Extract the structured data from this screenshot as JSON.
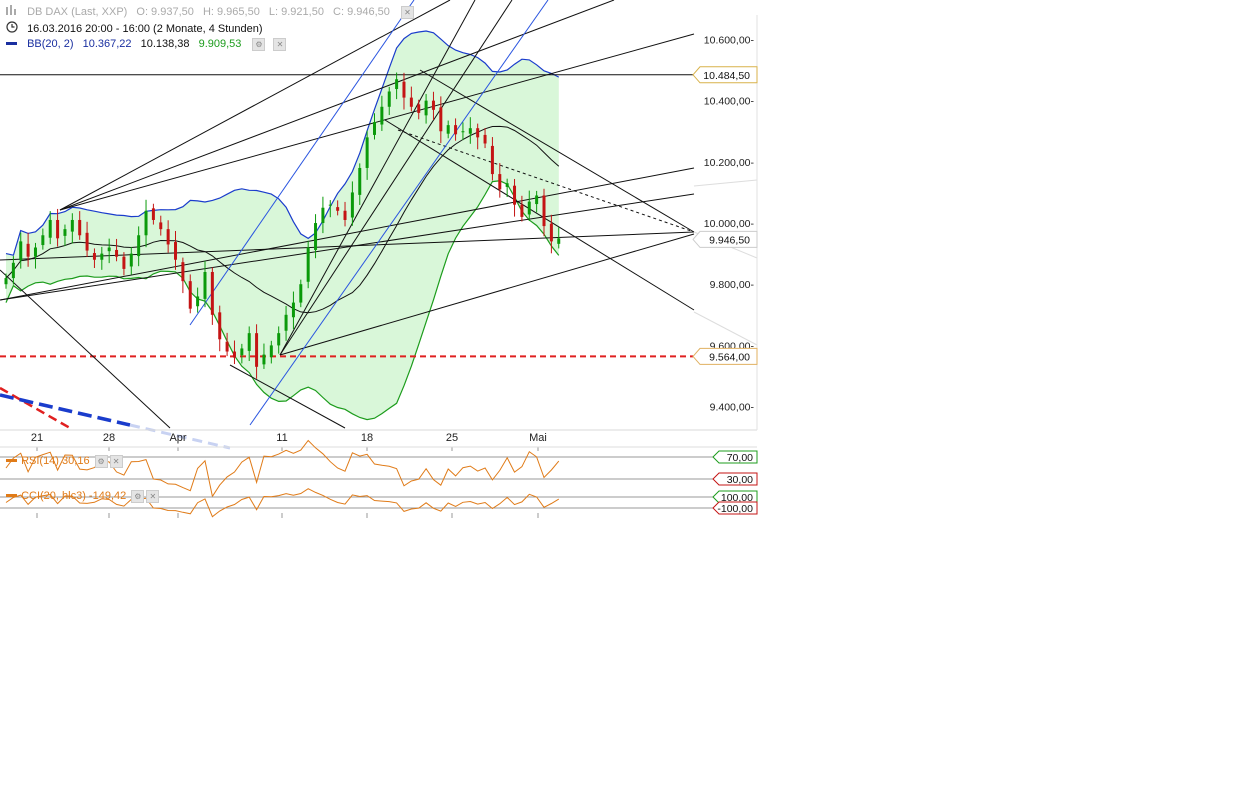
{
  "header": {
    "instrument": "DB DAX (Last, XXP)",
    "open": "O: 9.937,50",
    "high": "H: 9.965,50",
    "low": "L: 9.921,50",
    "close": "C: 9.946,50",
    "period": "16.03.2016 20:00 - 16:00 (2 Monate, 4 Stunden)",
    "bb_name": "BB(20, 2)",
    "bb_upper": "10.367,22",
    "bb_mid": "10.138,38",
    "bb_lower": "9.909,53"
  },
  "colors": {
    "up": "#0a9a0a",
    "down": "#c41414",
    "bb_line": "#1a3ccc",
    "bb_fill": "#d9f7d9",
    "bb_green": "#1c9c1c",
    "trend": "#111111",
    "channel_blue": "#2a55e0",
    "support": "#e02020",
    "indicator": "#e07b18"
  },
  "price_axis": {
    "ticks": [
      "10.600,00",
      "10.400,00",
      "10.200,00",
      "10.000,00",
      "9.800,00",
      "9.600,00",
      "9.400,00"
    ],
    "labels": [
      {
        "text": "10.484,50",
        "kind": "resistance"
      },
      {
        "text": "9.946,50",
        "kind": "last"
      },
      {
        "text": "9.564,00",
        "kind": "support"
      }
    ]
  },
  "date_axis": [
    "21",
    "28",
    "Apr",
    "11",
    "18",
    "25",
    "Mai"
  ],
  "rsi": {
    "label": "RSI(14)",
    "value": "30,16",
    "upper": "70,00",
    "lower": "30,00"
  },
  "cci": {
    "label": "CCI(20, hlc3)",
    "value": "-149,42",
    "upper": "100,00",
    "lower": "-100,00"
  },
  "chart_data": {
    "type": "candlestick",
    "title": "DB DAX (Last, XXP)",
    "x_labels": [
      "21",
      "28",
      "Apr",
      "11",
      "18",
      "25",
      "Mai"
    ],
    "ylim": [
      9330,
      10680
    ],
    "last_ohlc": {
      "open": 9937.5,
      "high": 9965.5,
      "low": 9921.5,
      "close": 9946.5
    },
    "closes": [
      9820,
      9870,
      9940,
      9890,
      9920,
      9960,
      10010,
      9950,
      9980,
      10010,
      9960,
      9910,
      9880,
      9900,
      9920,
      9890,
      9850,
      9900,
      9960,
      10040,
      10010,
      9980,
      9930,
      9880,
      9810,
      9720,
      9760,
      9840,
      9700,
      9620,
      9580,
      9560,
      9590,
      9640,
      9530,
      9570,
      9600,
      9640,
      9700,
      9740,
      9800,
      9920,
      10000,
      10050,
      10060,
      10040,
      10010,
      10100,
      10180,
      10280,
      10330,
      10380,
      10430,
      10470,
      10410,
      10380,
      10360,
      10400,
      10370,
      10300,
      10320,
      10290,
      10300,
      10310,
      10280,
      10260,
      10160,
      10110,
      10130,
      10060,
      10020,
      10070,
      10090,
      9990,
      9940,
      9950
    ],
    "bollinger": {
      "period": 20,
      "stddev": 2,
      "upper": 10367.22,
      "middle": 10138.38,
      "lower": 9909.53
    },
    "horizontal_lines": [
      {
        "value": 10484.5,
        "style": "solid"
      },
      {
        "value": 9564,
        "style": "dashed-red"
      }
    ],
    "rsi": {
      "period": 14,
      "value": 30.16,
      "bounds": [
        30,
        70
      ]
    },
    "cci": {
      "period": 20,
      "value": -149.42,
      "bounds": [
        -100,
        100
      ]
    }
  }
}
